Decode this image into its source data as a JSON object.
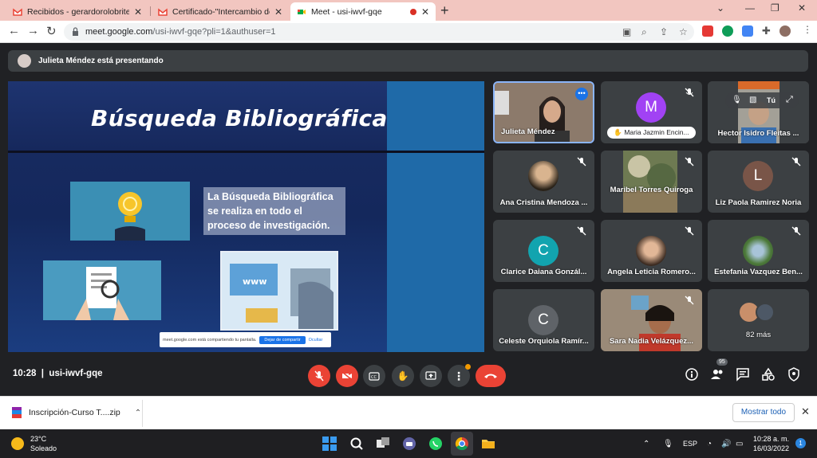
{
  "tabs": [
    {
      "title": "Recibidos - gerardorolobritez@g",
      "icon": "gmail-icon"
    },
    {
      "title": "Certificado-\"Intercambio de Expe",
      "icon": "gmail-icon"
    },
    {
      "title": "Meet - usi-iwvf-gqe",
      "icon": "meet-icon"
    }
  ],
  "address": {
    "url_main": "meet.google.com",
    "url_rest": "/usi-iwvf-gqe?pli=1&authuser=1"
  },
  "presenting": "Julieta Méndez está presentando",
  "slide": {
    "title": "Búsqueda Bibliográfica",
    "text_lines": [
      "La Búsqueda Bibliográfica",
      "se realiza en todo el",
      "proceso de investigación."
    ],
    "share_text": "meet.google.com está compartiendo tu pantalla.",
    "share_stop": "Dejar de compartir",
    "share_hide": "Ocultar"
  },
  "participants": [
    {
      "name": "Julieta Méndez",
      "type": "video"
    },
    {
      "name": "Maria Jazmin Encin...",
      "type": "avatar",
      "initial": "M",
      "color": "#a142f4"
    },
    {
      "name": "Hector Isidro Fleitas ...",
      "type": "video",
      "self_label": "Tú"
    },
    {
      "name": "Ana Cristina Mendoza ...",
      "type": "photo"
    },
    {
      "name": "Maribel Torres Quiroga",
      "type": "video"
    },
    {
      "name": "Liz Paola Ramirez Noria",
      "type": "avatar",
      "initial": "L",
      "color": "#795548"
    },
    {
      "name": "Clarice Daiana Gonzál...",
      "type": "avatar",
      "initial": "C",
      "color": "#12a4af"
    },
    {
      "name": "Angela Leticia Romero...",
      "type": "photo"
    },
    {
      "name": "Estefania Vazquez Ben...",
      "type": "photo"
    },
    {
      "name": "Celeste Orquiola Ramír...",
      "type": "avatar",
      "initial": "C",
      "color": "#5f6368"
    },
    {
      "name": "Sara Nadia Velázquez...",
      "type": "video"
    },
    {
      "name": "82 más",
      "type": "more"
    }
  ],
  "meeting": {
    "time": "10:28",
    "code": "usi-iwvf-gqe",
    "participant_count": "95"
  },
  "download": {
    "file": "Inscripción-Curso T....zip",
    "show_all": "Mostrar todo"
  },
  "taskbar": {
    "temp": "23°C",
    "weather": "Soleado",
    "lang": "ESP",
    "time": "10:28 a. m.",
    "date": "16/03/2022",
    "notifications": "1"
  }
}
